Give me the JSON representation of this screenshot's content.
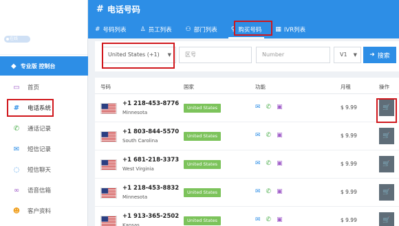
{
  "sidebar": {
    "online_label": "在线",
    "pro_label": "专业版 控制台",
    "items": [
      {
        "label": "首页",
        "icon": "monitor-icon",
        "glyph": "▭"
      },
      {
        "label": "电话系统",
        "icon": "hash-icon",
        "glyph": "#"
      },
      {
        "label": "通话记录",
        "icon": "phone-icon",
        "glyph": "✆"
      },
      {
        "label": "短信记录",
        "icon": "envelope-icon",
        "glyph": "✉"
      },
      {
        "label": "短信聊天",
        "icon": "chat-icon",
        "glyph": "◌"
      },
      {
        "label": "语音信箱",
        "icon": "voicemail-icon",
        "glyph": "∞"
      },
      {
        "label": "客户资料",
        "icon": "user-icon",
        "glyph": "☻"
      }
    ]
  },
  "header": {
    "title": "电话号码",
    "tabs": [
      {
        "label": "号码列表",
        "icon": "hash-icon",
        "glyph": "#"
      },
      {
        "label": "员工列表",
        "icon": "user-icon",
        "glyph": "♙"
      },
      {
        "label": "部门列表",
        "icon": "group-icon",
        "glyph": "⚇"
      },
      {
        "label": "购买号码",
        "icon": "search-icon",
        "glyph": "⚲"
      },
      {
        "label": "IVR列表",
        "icon": "grid-icon",
        "glyph": "▦"
      }
    ]
  },
  "search": {
    "country_value": "United States (+1)",
    "area_placeholder": "区号",
    "number_placeholder": "Number",
    "version_value": "V1",
    "button_label": "搜索"
  },
  "table": {
    "headers": {
      "number": "号码",
      "country": "国家",
      "features": "功能",
      "monthly": "月租",
      "action": "操作"
    },
    "rows": [
      {
        "number": "+1 218-453-8776",
        "state": "Minnesota",
        "country": "United States",
        "price": "$ 9.99"
      },
      {
        "number": "+1 803-844-5570",
        "state": "South Carolina",
        "country": "United States",
        "price": "$ 9.99"
      },
      {
        "number": "+1 681-218-3373",
        "state": "West Virginia",
        "country": "United States",
        "price": "$ 9.99"
      },
      {
        "number": "+1 218-453-8832",
        "state": "Minnesota",
        "country": "United States",
        "price": "$ 9.99"
      },
      {
        "number": "+1 913-365-2502",
        "state": "Kansas",
        "country": "United States",
        "price": "$ 9.99"
      }
    ]
  },
  "colors": {
    "accent": "#2d8ee6",
    "badge": "#7cc35b",
    "highlight": "#d0161b",
    "cart": "#5f6d78"
  }
}
